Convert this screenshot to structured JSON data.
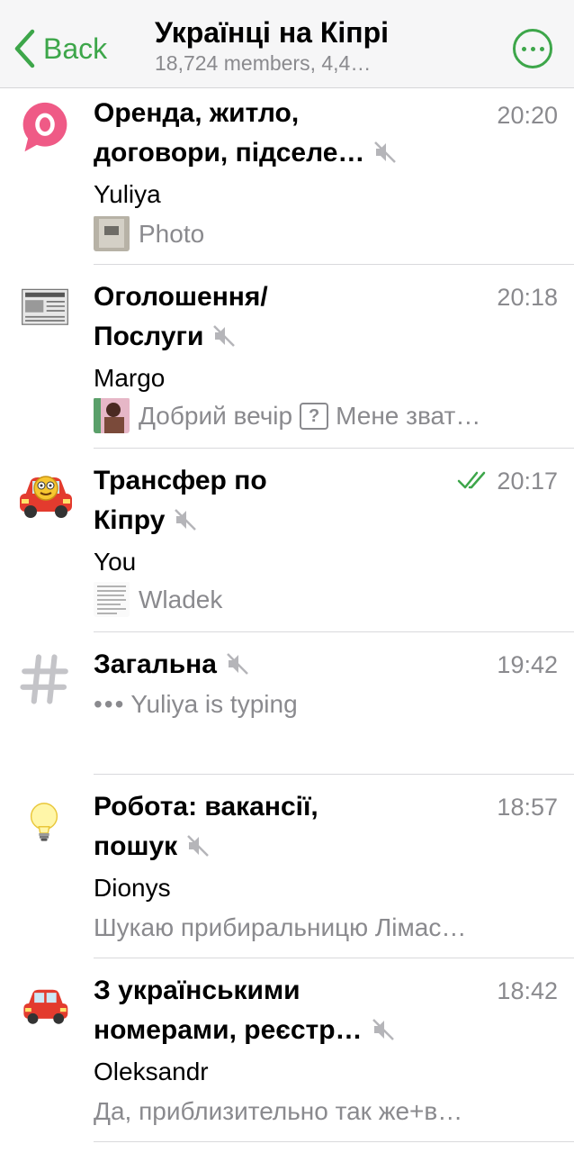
{
  "header": {
    "back_label": "Back",
    "title": "Українці на Кіпрі",
    "subtitle": "18,724 members, 4,4…"
  },
  "colors": {
    "accent": "#3da64a",
    "muted": "#8a8a8e",
    "separator": "#d9d9dc"
  },
  "chats": [
    {
      "title_line1": "Оренда, житло,",
      "title_line2": "договори, підселе…",
      "time": "20:20",
      "sender": "Yuliya",
      "preview": "Photo",
      "muted": true,
      "avatar_icon": "pink-speech-bubble-o-icon"
    },
    {
      "title_line1": "Оголошення/",
      "title_line2": "Послуги",
      "time": "20:18",
      "sender": "Margo",
      "preview_a": "Добрий вечір",
      "preview_b": "Мене зват…",
      "muted": true,
      "avatar_icon": "newspaper-icon"
    },
    {
      "title_line1": "Трансфер по",
      "title_line2": "Кіпру",
      "time": "20:17",
      "sender": "You",
      "preview": "Wladek",
      "muted": true,
      "read": true,
      "avatar_icon": "car-with-emoji-face-icon"
    },
    {
      "title_line1": "Загальна",
      "time": "19:42",
      "typing": "Yuliya is typing",
      "muted": true,
      "avatar_icon": "hashtag-icon"
    },
    {
      "title_line1": "Робота: вакансії,",
      "title_line2": "пошук",
      "time": "18:57",
      "sender": "Dionys",
      "preview": "Шукаю прибиральницю Лімас…",
      "muted": true,
      "avatar_icon": "lightbulb-icon"
    },
    {
      "title_line1": "З українськими",
      "title_line2": "номерами, реєстр…",
      "time": "18:42",
      "sender": "Oleksandr",
      "preview": "Да, приблизительно так же+в…",
      "muted": true,
      "avatar_icon": "red-car-icon"
    }
  ]
}
